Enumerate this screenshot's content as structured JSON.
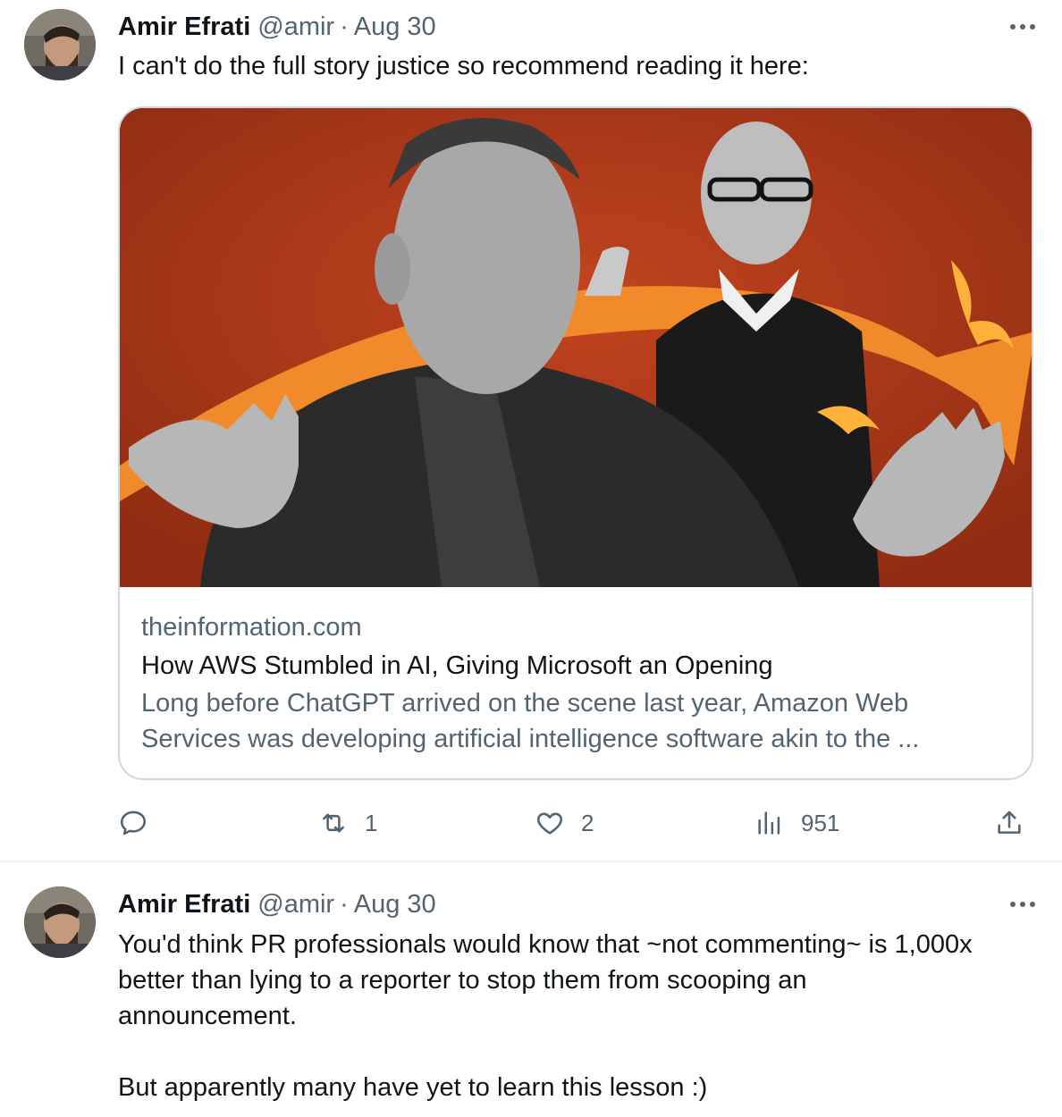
{
  "tweets": [
    {
      "author": {
        "name": "Amir Efrati",
        "handle": "@amir"
      },
      "separator": "·",
      "date": "Aug 30",
      "more_icon": "more-horizontal-icon",
      "text": "I can't do the full story justice so recommend reading it here:",
      "card": {
        "domain": "theinformation.com",
        "title": "How AWS Stumbled in AI, Giving Microsoft an Opening",
        "description_line1": "Long before ChatGPT arrived on the scene last year, Amazon Web",
        "description_line2": "Services was developing artificial intelligence software akin to the ...",
        "image_colors": {
          "background": "#b43a1a",
          "swoosh": "#f08a2a"
        }
      },
      "actions": {
        "reply": {
          "icon": "reply-icon",
          "count": ""
        },
        "retweet": {
          "icon": "retweet-icon",
          "count": "1"
        },
        "like": {
          "icon": "heart-icon",
          "count": "2"
        },
        "views": {
          "icon": "views-icon",
          "count": "951"
        },
        "share": {
          "icon": "share-icon",
          "count": ""
        }
      }
    },
    {
      "author": {
        "name": "Amir Efrati",
        "handle": "@amir"
      },
      "separator": "·",
      "date": "Aug 30",
      "more_icon": "more-horizontal-icon",
      "text_lines": [
        "You'd think PR professionals would know that ~not commenting~ is 1,000x",
        "better than lying to a reporter to stop them from scooping an",
        "announcement.",
        "But apparently many have yet to learn this lesson :)"
      ]
    }
  ],
  "colors": {
    "text": "#0f1419",
    "secondary": "#536471",
    "border": "#cfd9de"
  }
}
